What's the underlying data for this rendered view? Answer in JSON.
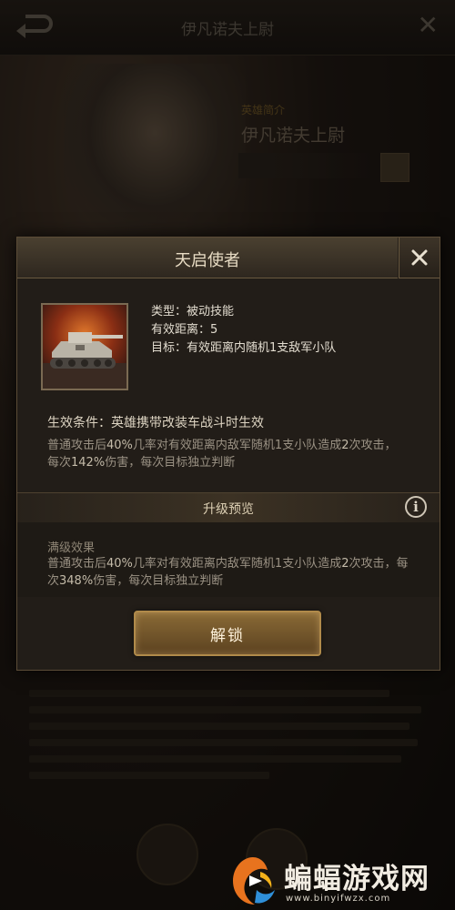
{
  "background": {
    "title": "伊凡诺夫上尉",
    "subtitle": "英雄简介",
    "hero_name": "伊凡诺夫上尉"
  },
  "dialog": {
    "title": "天启使者",
    "skill_icon": "tank-skill-icon",
    "type_label": "类型：被动技能",
    "range_label": "有效距离：5",
    "target_label": "目标：有效距离内随机1支敌军小队",
    "condition": "生效条件：英雄携带改装车战斗时生效",
    "desc": {
      "p1": "普通攻击后",
      "v1": "40%",
      "p2": "几率对有效距离内敌军随机1支小队造成",
      "v2": "2",
      "p3": "次攻击，每次",
      "v3": "142%",
      "p4": "伤害，每次目标独立判断"
    },
    "upgrade_title": "升级预览",
    "full_title": "满级效果",
    "full_desc": {
      "p1": "普通攻击后",
      "v1": "40%",
      "p2": "几率对有效距离内敌军随机1支小队造成",
      "v2": "2",
      "p3": "次攻击，每次",
      "v3": "348%",
      "p4": "伤害，每次目标独立判断"
    },
    "unlock_label": "解锁"
  },
  "watermark": {
    "text": "蝙蝠游戏网",
    "url": "www.binyifwzx.com"
  },
  "colors": {
    "accent_gold": "#b08a4a",
    "panel_bg": "#221d18",
    "highlight_text": "#c4bba9"
  }
}
